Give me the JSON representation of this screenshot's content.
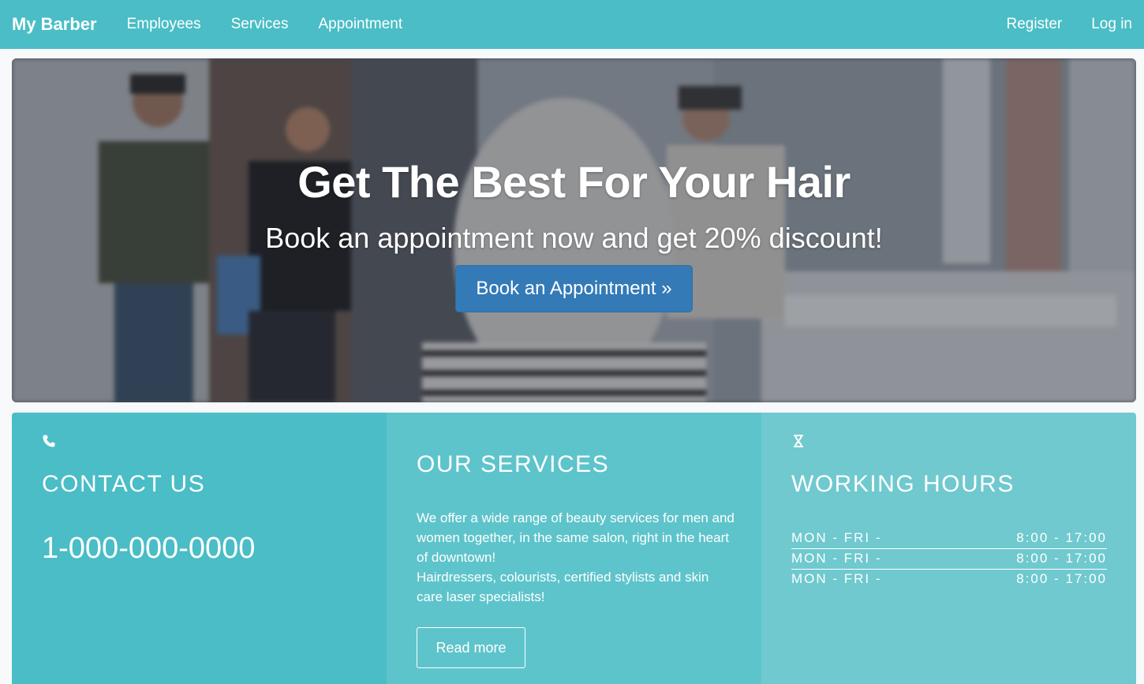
{
  "navbar": {
    "brand": "My Barber",
    "links": [
      {
        "label": "Employees"
      },
      {
        "label": "Services"
      },
      {
        "label": "Appointment"
      }
    ],
    "right_links": [
      {
        "label": "Register"
      },
      {
        "label": "Log in"
      }
    ]
  },
  "hero": {
    "title": "Get The Best For Your Hair",
    "subtitle": "Book an appointment now and get 20% discount!",
    "button_label": "Book an Appointment »"
  },
  "contact": {
    "icon": "phone-icon",
    "heading": "CONTACT US",
    "phone": "1-000-000-0000"
  },
  "services": {
    "heading": "OUR SERVICES",
    "text_line1": "We offer a wide range of beauty services for men and women together, in the same salon, right in the heart of downtown!",
    "text_line2": "Hairdressers, colourists, certified stylists and skin care laser specialists!",
    "button_label": "Read more"
  },
  "hours": {
    "icon": "hourglass-icon",
    "heading": "WORKING HOURS",
    "rows": [
      {
        "days": "MON - FRI -",
        "time": "8:00 - 17:00"
      },
      {
        "days": "MON - FRI -",
        "time": "8:00 - 17:00"
      },
      {
        "days": "MON - FRI -",
        "time": "8:00 - 17:00"
      }
    ]
  },
  "colors": {
    "navbar": "#4abdc6",
    "primary_button": "#337ab7",
    "panel_contact": "#4abdc6",
    "panel_services": "#5ec4cb",
    "panel_hours": "#6fc9cf"
  }
}
